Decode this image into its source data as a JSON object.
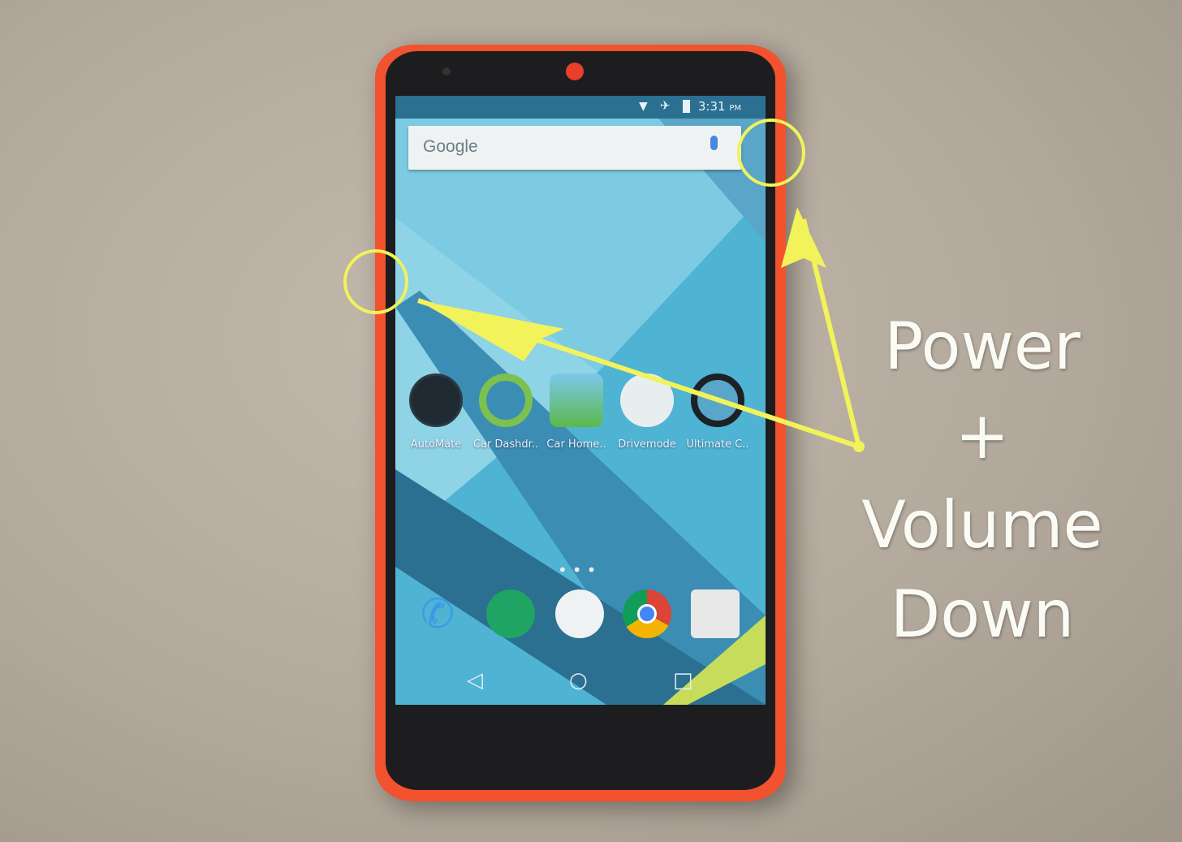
{
  "status_bar": {
    "time": "3:31",
    "ampm": "PM",
    "icons": [
      "wifi-icon",
      "airplane-icon",
      "battery-icon"
    ]
  },
  "search": {
    "logo": "Google",
    "icon": "mic-icon"
  },
  "apps": [
    {
      "label": "AutoMate"
    },
    {
      "label": "Car Dashdr.."
    },
    {
      "label": "Car Home.."
    },
    {
      "label": "Drivemode"
    },
    {
      "label": "Ultimate C.."
    }
  ],
  "dock": [
    "phone-icon",
    "hangouts-icon",
    "app-drawer-icon",
    "chrome-icon",
    "camera-icon"
  ],
  "annotation": {
    "line1": "Power",
    "line2": "+",
    "line3": "Volume",
    "line4": "Down",
    "color": "#f2f25a"
  },
  "colors": {
    "phone": "#f2522e",
    "annotation": "#f2f25a"
  }
}
